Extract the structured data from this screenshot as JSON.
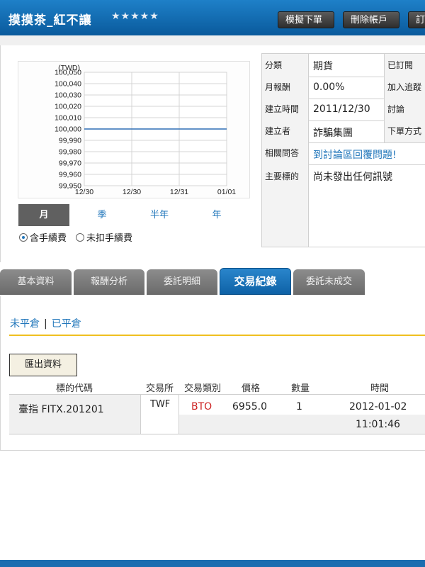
{
  "header": {
    "title": "摸摸茶_紅不讓",
    "stars": "★★★★★",
    "buttons": {
      "simulate_order": "模擬下單",
      "delete_account": "刪除帳戶",
      "subscribe_partial": "訂"
    }
  },
  "chart_data": {
    "type": "line",
    "unit_label": "(TWD)",
    "x": [
      "12/30",
      "12/30",
      "12/31",
      "01/01"
    ],
    "series": [
      {
        "values": [
          100000,
          100000,
          100000,
          100000
        ]
      }
    ],
    "y_ticks": [
      "100,050",
      "100,040",
      "100,030",
      "100,020",
      "100,010",
      "100,000",
      "99,990",
      "99,980",
      "99,970",
      "99,960",
      "99,950"
    ],
    "ylim": [
      99950,
      100050
    ],
    "grid": true,
    "line_color": "#2f6fb5"
  },
  "period_tabs": [
    "月",
    "季",
    "半年",
    "年"
  ],
  "fee_options": {
    "with_fee": "含手續費",
    "without_fee": "未扣手續費",
    "selected": "with_fee"
  },
  "info": {
    "category": {
      "label": "分類",
      "value": "期貨",
      "right": "已訂閱"
    },
    "monthly_return": {
      "label": "月報酬",
      "value": "0.00%",
      "right": "加入追蹤"
    },
    "created_time": {
      "label": "建立時間",
      "value": "2011/12/30",
      "right": "討論"
    },
    "creator": {
      "label": "建立者",
      "value": "詐騙集團",
      "right": "下單方式"
    },
    "qa": {
      "label": "相關問答",
      "link": "到討論區回覆問題!"
    },
    "main_target": {
      "label": "主要標的",
      "value": "尚未發出任何訊號"
    }
  },
  "tabs": [
    {
      "label": "基本資料",
      "active": false
    },
    {
      "label": "報酬分析",
      "active": false
    },
    {
      "label": "委託明細",
      "active": false
    },
    {
      "label": "交易紀錄",
      "active": true
    },
    {
      "label": "委託未成交",
      "active": false
    }
  ],
  "position_toggle": {
    "open": "未平倉",
    "separator": "|",
    "closed": "已平倉"
  },
  "export_label": "匯出資料",
  "table": {
    "headers": {
      "symbol": "標的代碼",
      "exchange": "交易所",
      "type": "交易類別",
      "price": "價格",
      "qty": "數量",
      "time": "時間"
    },
    "rows": [
      {
        "symbol": "臺指 FITX.201201",
        "exchange": "TWF",
        "type": "BTO",
        "price": "6955.0",
        "qty": "1",
        "date": "2012-01-02",
        "time": "11:01:46"
      }
    ]
  },
  "colors": {
    "header_blue": "#0a5a9c",
    "link_blue": "#2277bb",
    "accent_gold": "#f0c020",
    "bto_red": "#cc2222"
  }
}
